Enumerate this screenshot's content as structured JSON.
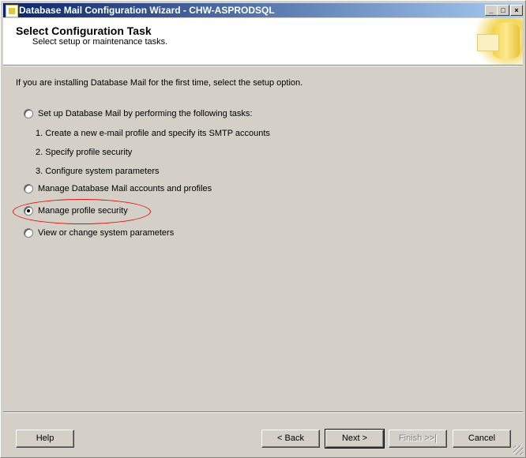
{
  "window": {
    "title": "Database Mail Configuration Wizard - CHW-ASPRODSQL",
    "controls": {
      "minimize": "_",
      "maximize": "□",
      "close": "×"
    }
  },
  "header": {
    "title": "Select Configuration Task",
    "subtitle": "Select setup or maintenance tasks."
  },
  "main": {
    "intro": "If you are installing Database Mail for the first time, select the setup option.",
    "options": [
      {
        "label": "Set up Database Mail by performing the following tasks:",
        "checked": false
      },
      {
        "label": "Manage Database Mail accounts and profiles",
        "checked": false
      },
      {
        "label": "Manage profile security",
        "checked": true
      },
      {
        "label": "View or change system parameters",
        "checked": false
      }
    ],
    "setup_tasks": [
      "1. Create a new e-mail profile and specify its SMTP accounts",
      "2. Specify profile security",
      "3. Configure system parameters"
    ]
  },
  "buttons": {
    "help": "Help",
    "back": "< Back",
    "next": "Next >",
    "finish": "Finish >>|",
    "cancel": "Cancel"
  },
  "colors": {
    "title_bar_start": "#0a246a",
    "title_bar_end": "#a6caf0",
    "annotation": "#e01010"
  }
}
